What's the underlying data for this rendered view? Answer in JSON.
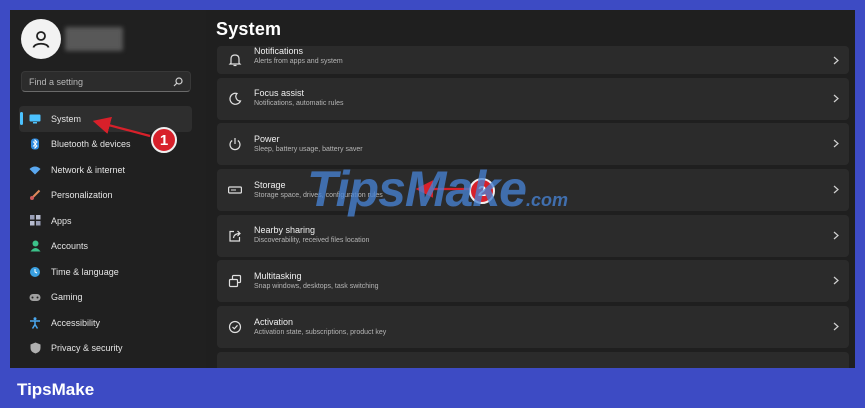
{
  "sidebar": {
    "search_placeholder": "Find a setting",
    "items": [
      {
        "label": "System",
        "icon": "monitor-icon",
        "color": "#4cc2ff",
        "active": true
      },
      {
        "label": "Bluetooth & devices",
        "icon": "bluetooth-icon",
        "color": "#2e8be0"
      },
      {
        "label": "Network & internet",
        "icon": "wifi-icon",
        "color": "#5aa8f0"
      },
      {
        "label": "Personalization",
        "icon": "brush-icon",
        "color": "#e08a5a"
      },
      {
        "label": "Apps",
        "icon": "apps-grid-icon",
        "color": "#9aa0b8"
      },
      {
        "label": "Accounts",
        "icon": "person-icon",
        "color": "#3cc28a"
      },
      {
        "label": "Time & language",
        "icon": "globe-clock-icon",
        "color": "#3aa0e0"
      },
      {
        "label": "Gaming",
        "icon": "gamepad-icon",
        "color": "#a0a0a0"
      },
      {
        "label": "Accessibility",
        "icon": "accessibility-icon",
        "color": "#4aa8f0"
      },
      {
        "label": "Privacy & security",
        "icon": "shield-icon",
        "color": "#b0b0b0"
      }
    ]
  },
  "main": {
    "title": "System",
    "cards": [
      {
        "title": "Notifications",
        "subtitle": "Alerts from apps and system",
        "icon": "bell-icon"
      },
      {
        "title": "Focus assist",
        "subtitle": "Notifications, automatic rules",
        "icon": "moon-icon"
      },
      {
        "title": "Power",
        "subtitle": "Sleep, battery usage, battery saver",
        "icon": "power-icon"
      },
      {
        "title": "Storage",
        "subtitle": "Storage space, drives, configuration rules",
        "icon": "storage-drive-icon"
      },
      {
        "title": "Nearby sharing",
        "subtitle": "Discoverability, received files location",
        "icon": "share-icon"
      },
      {
        "title": "Multitasking",
        "subtitle": "Snap windows, desktops, task switching",
        "icon": "multitask-windows-icon"
      },
      {
        "title": "Activation",
        "subtitle": "Activation state, subscriptions, product key",
        "icon": "check-circle-icon"
      }
    ]
  },
  "annotations": {
    "step1": "1",
    "step2": "2"
  },
  "watermark": {
    "main": "TipsMake",
    "suffix": ".com"
  },
  "brand": "TipsMake",
  "colors": {
    "accent": "#4cc2ff",
    "background": "#3d4bc4",
    "badge": "#d8202a"
  }
}
